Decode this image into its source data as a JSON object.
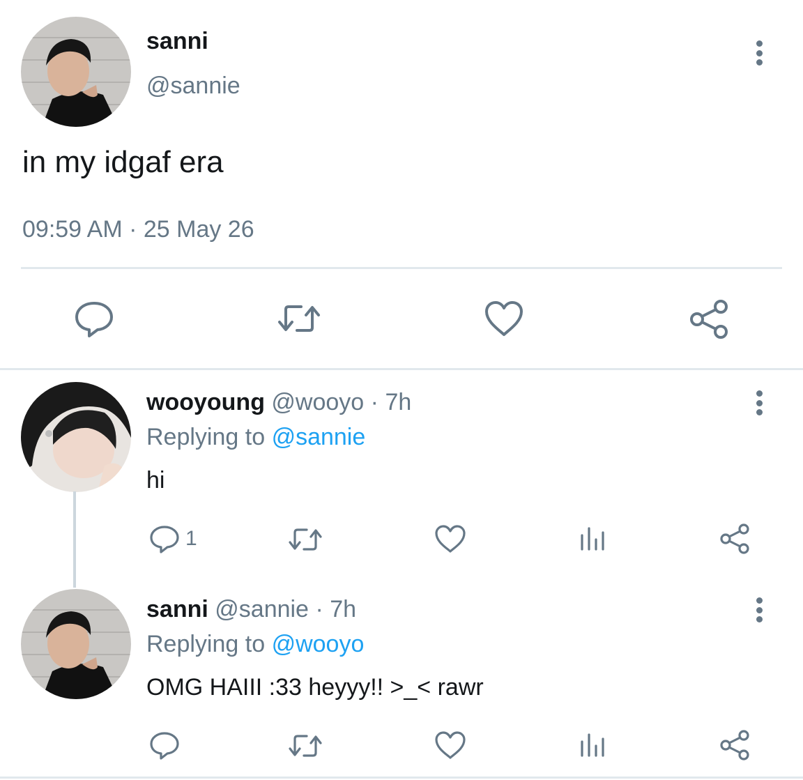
{
  "main_tweet": {
    "name": "sanni",
    "handle": "@sannie",
    "text": "in my idgaf era",
    "timestamp": "09:59 AM · 25 May 26",
    "actions": [
      "reply-icon",
      "retweet-icon",
      "like-icon",
      "share-icon"
    ]
  },
  "replies": [
    {
      "name": "wooyoung",
      "handle": "@wooyo",
      "time": "7h",
      "replying_prefix": "Replying to",
      "replying_to": "@sannie",
      "text": "hi",
      "reply_count": "1",
      "actions": [
        "reply-icon",
        "retweet-icon",
        "like-icon",
        "views-icon",
        "share-icon"
      ]
    },
    {
      "name": "sanni",
      "handle": "@sannie",
      "time": "7h",
      "replying_prefix": "Replying to",
      "replying_to": "@wooyo",
      "text": "OMG HAIII :33 heyyy!! >_< rawr",
      "reply_count": "",
      "actions": [
        "reply-icon",
        "retweet-icon",
        "like-icon",
        "views-icon",
        "share-icon"
      ]
    }
  ],
  "colors": {
    "primary_text": "#14171a",
    "secondary_text": "#657786",
    "mention": "#1da1f2",
    "divider": "#e1e8ed"
  }
}
